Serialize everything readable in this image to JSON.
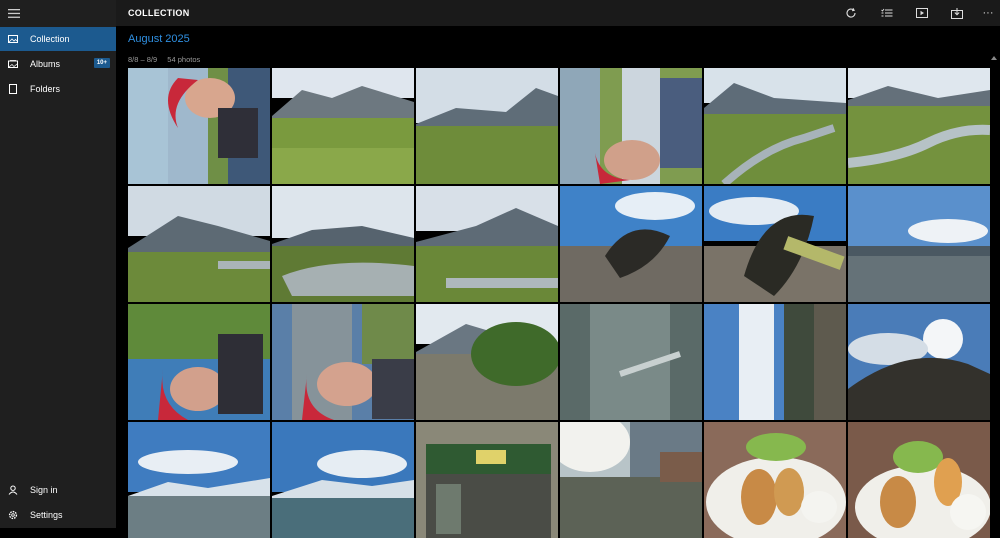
{
  "app": {
    "title": "COLLECTION"
  },
  "nav": {
    "items": [
      {
        "label": "Collection",
        "icon": "collection-icon",
        "active": true
      },
      {
        "label": "Albums",
        "icon": "albums-icon",
        "badge": "10+"
      },
      {
        "label": "Folders",
        "icon": "folders-icon"
      }
    ],
    "bottom": [
      {
        "label": "Sign in",
        "icon": "user-icon"
      },
      {
        "label": "Settings",
        "icon": "gear-icon"
      }
    ]
  },
  "toolbar": {
    "icons": [
      "refresh-icon",
      "select-icon",
      "slideshow-icon",
      "import-icon"
    ],
    "more": "···"
  },
  "group": {
    "title": "August 2025",
    "date_range": "8/8 – 8/9",
    "count": "54 photos"
  },
  "colors": {
    "accent": "#2f8fe0",
    "active_nav": "#1c5a8f",
    "sidebar": "#1f1f1f",
    "topbar": "#1a1a1a"
  }
}
